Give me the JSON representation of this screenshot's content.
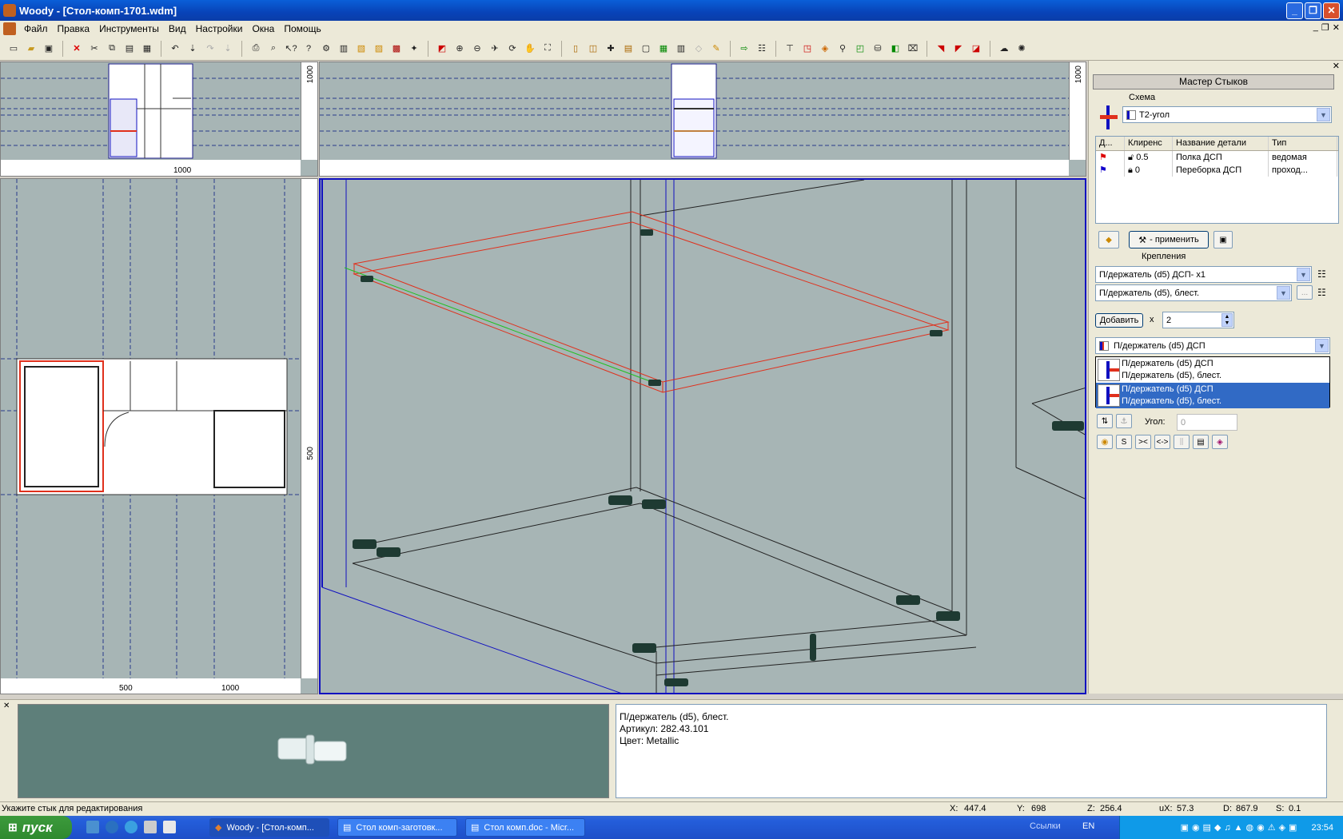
{
  "window": {
    "title": "Woody - [Стол-комп-1701.wdm]"
  },
  "menu": [
    "Файл",
    "Правка",
    "Инструменты",
    "Вид",
    "Настройки",
    "Окна",
    "Помощь"
  ],
  "toolbar_icons": [
    "new-icon",
    "open-icon",
    "save-icon",
    "delete-icon",
    "cut-icon",
    "copy-icon",
    "paste-icon",
    "properties-icon",
    "undo-icon",
    "redo-icon",
    "print-icon",
    "print-preview-icon",
    "help-icon",
    "whats-this-icon"
  ],
  "views": {
    "top_left_ruler": {
      "tick": "1000",
      "bottom_tick": "1000"
    },
    "top_mid_ruler": {
      "tick": "1000"
    },
    "left_ruler": {
      "v_tick": "500",
      "h_tick_1": "500",
      "h_tick_2": "1000"
    }
  },
  "right_panel": {
    "title": "Мастер Стыков",
    "scheme_label": "Схема",
    "scheme_value": "Т2-угол",
    "grid": {
      "headers": [
        "Д...",
        "Клиренс",
        "Название детали",
        "Тип"
      ],
      "rows": [
        {
          "clearance": "0.5",
          "name": "Полка ДСП",
          "type": "ведомая"
        },
        {
          "clearance": "0",
          "name": "Переборка ДСП",
          "type": "проход..."
        }
      ]
    },
    "apply_label": "- применить",
    "fasteners_label": "Крепления",
    "fastener_1": "П/держатель (d5) ДСП- x1",
    "fastener_2": "П/держатель (d5), блест.",
    "add_label": "Добавить",
    "x_label": "x",
    "count": "2",
    "dropdown_value": "П/держатель (d5) ДСП",
    "dropdown_items": [
      {
        "line1": "П/держатель (d5) ДСП",
        "line2": "П/держатель (d5), блест."
      },
      {
        "line1": "П/держатель (d5) ДСП",
        "line2": "П/держатель (d5), блест."
      }
    ],
    "angle_label": "Угол:",
    "angle_value": "0",
    "tool_s": "S",
    "tool_join": "><",
    "tool_split": "<->"
  },
  "info": {
    "line1": "П/держатель (d5), блест.",
    "line2": "Артикул: 282.43.101",
    "line3": "Цвет: Metallic"
  },
  "status": {
    "hint": "Укажите стык для редактирования",
    "x_label": "X:",
    "x": "447.4",
    "y_label": "Y:",
    "y": "698",
    "z_label": "Z:",
    "z": "256.4",
    "ux_label": "uX:",
    "ux": "57.3",
    "d_label": "D:",
    "d": "867.9",
    "s_label": "S:",
    "s": "0.1"
  },
  "taskbar": {
    "start": "пуск",
    "tasks": [
      "Woody - [Стол-комп...",
      "Стол комп-заготовк...",
      "Стол комп.doc - Micr..."
    ],
    "links": "Ссылки",
    "lang": "EN",
    "clock": "23:54"
  },
  "colors": {
    "viewport_bg": "#a7b5b5",
    "selection": "#316ac5",
    "edge_red": "#e0301c",
    "edge_blue": "#1010c0"
  }
}
